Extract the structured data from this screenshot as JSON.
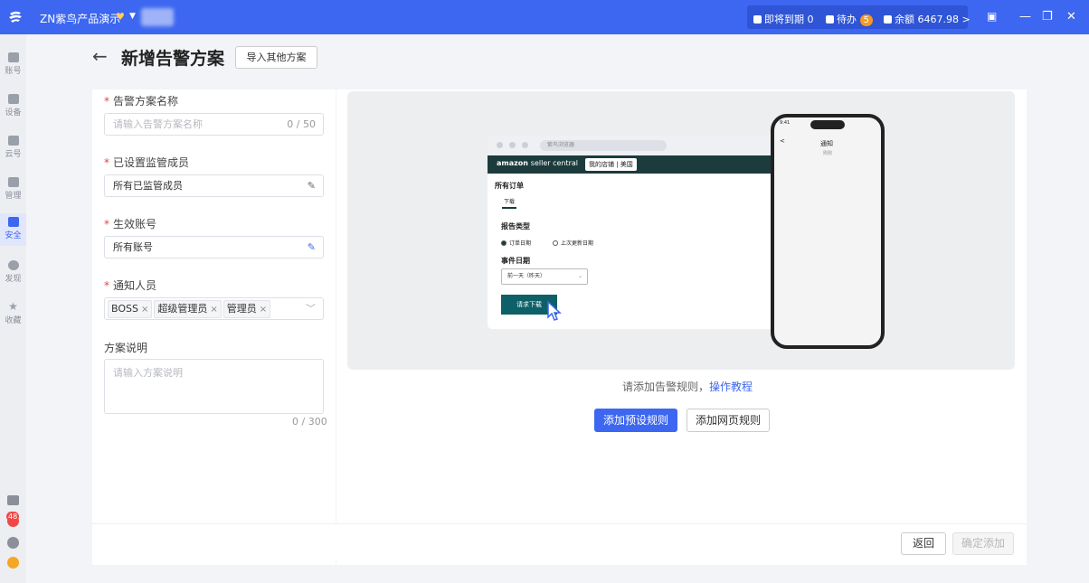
{
  "titlebar": {
    "org_name": "ZN紫鸟产品演示",
    "expiring_label": "即将到期",
    "expiring_count": "0",
    "todo_label": "待办",
    "todo_count": "5",
    "balance_label": "余额",
    "balance_value": "6467.98",
    "balance_arrow": ">",
    "minimize": "—",
    "restore": "❐",
    "close": "✕"
  },
  "sidebar": {
    "items": [
      {
        "label": "账号"
      },
      {
        "label": "设备"
      },
      {
        "label": "云号"
      },
      {
        "label": "管理"
      },
      {
        "label": "安全"
      },
      {
        "label": "发现"
      },
      {
        "label": "收藏"
      }
    ],
    "notification_count": "48"
  },
  "page": {
    "back_arrow": "←",
    "title": "新增告警方案",
    "import_button": "导入其他方案"
  },
  "form": {
    "required_mark": "*",
    "name_label": "告警方案名称",
    "name_placeholder": "请输入告警方案名称",
    "name_counter": "0 / 50",
    "supervisor_label": "已设置监管成员",
    "supervisor_value": "所有已监管成员",
    "account_label": "生效账号",
    "account_value": "所有账号",
    "notify_label": "通知人员",
    "notify_tags": [
      "BOSS",
      "超级管理员",
      "管理员"
    ],
    "tag_remove": "×",
    "select_caret": "﹀",
    "edit_icon": "✎",
    "desc_label": "方案说明",
    "desc_placeholder": "请输入方案说明",
    "desc_counter": "0 / 300"
  },
  "preview": {
    "url_text": "紫鸟浏览器",
    "brand_bold": "amazon",
    "brand_rest": "seller central",
    "shop_label": "我的店铺 | 美国",
    "all_orders": "所有订单",
    "tab_download": "下载",
    "report_type": "报告类型",
    "radio_order_date": "订单日期",
    "radio_update_date": "上次更新日期",
    "event_date": "事件日期",
    "select_value": "前一天（昨天）",
    "request_button": "请求下载",
    "phone_back": "<",
    "phone_title": "通知",
    "phone_time": "9:41",
    "phone_sub": "刚刚"
  },
  "rules": {
    "hint": "请添加告警规则，",
    "tutorial_link": "操作教程",
    "add_preset_button": "添加预设规则",
    "add_web_button": "添加网页规则"
  },
  "footer": {
    "back_button": "返回",
    "confirm_button": "确定添加"
  }
}
